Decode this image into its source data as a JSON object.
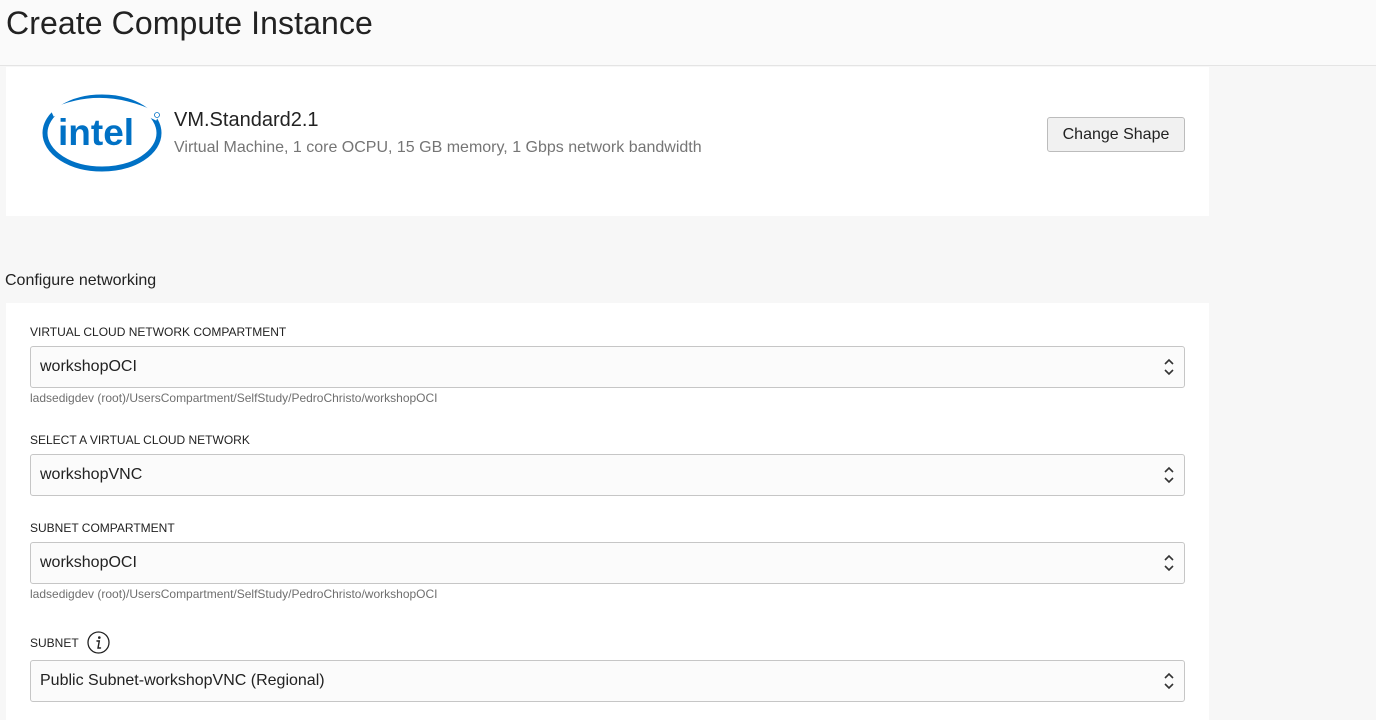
{
  "page": {
    "title": "Create Compute Instance"
  },
  "shape": {
    "logo_text": "intel",
    "name": "VM.Standard2.1",
    "description": "Virtual Machine, 1 core OCPU, 15 GB memory, 1 Gbps network bandwidth",
    "change_button": "Change Shape"
  },
  "networking": {
    "heading": "Configure networking",
    "fields": [
      {
        "label": "VIRTUAL CLOUD NETWORK COMPARTMENT",
        "value": "workshopOCI",
        "hint": "ladsedigdev (root)/UsersCompartment/SelfStudy/PedroChristo/workshopOCI"
      },
      {
        "label": "SELECT A VIRTUAL CLOUD NETWORK",
        "value": "workshopVNC"
      },
      {
        "label": "SUBNET COMPARTMENT",
        "value": "workshopOCI",
        "hint": "ladsedigdev (root)/UsersCompartment/SelfStudy/PedroChristo/workshopOCI"
      },
      {
        "label": "SUBNET",
        "value": "Public Subnet-workshopVNC (Regional)",
        "info_icon": "info-icon"
      }
    ]
  },
  "colors": {
    "intel_blue": "#0071c5",
    "border": "#c6c6c6"
  }
}
